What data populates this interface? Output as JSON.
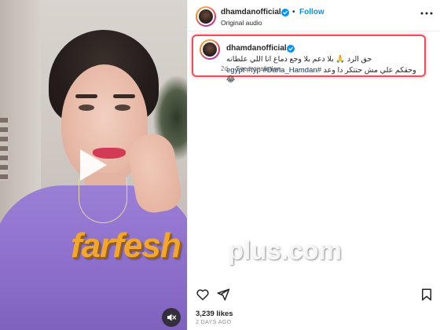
{
  "post": {
    "username": "dhamdanofficial",
    "follow_label": "Follow",
    "dot": "•",
    "audio_label": "Original audio"
  },
  "caption": {
    "line1": "حق الرد 🙏 بلا دعم بلا وجع دماغ انا اللي علطانه",
    "hashtags": "egypt #fyp #Dana_Hamdan#",
    "line2_rest": " وحقكم علي مش حتتكر دا وعد 😂",
    "age": "2d",
    "see_translation": "See translation"
  },
  "stats": {
    "likes": "3,239 likes",
    "time_ago": "2 DAYS AGO"
  },
  "watermark": {
    "brand": "farfesh",
    "domain": "plus.com"
  },
  "icons": {
    "play": "play-icon",
    "mute": "mute-icon",
    "verified": "verified-badge-icon",
    "more": "more-options-icon",
    "like": "heart-icon",
    "share": "send-icon",
    "save": "bookmark-icon"
  },
  "colors": {
    "accent": "#0095f6",
    "highlight": "#f24b5a",
    "watermark": "#f2a62b",
    "shirt": "#8a6cc9"
  }
}
